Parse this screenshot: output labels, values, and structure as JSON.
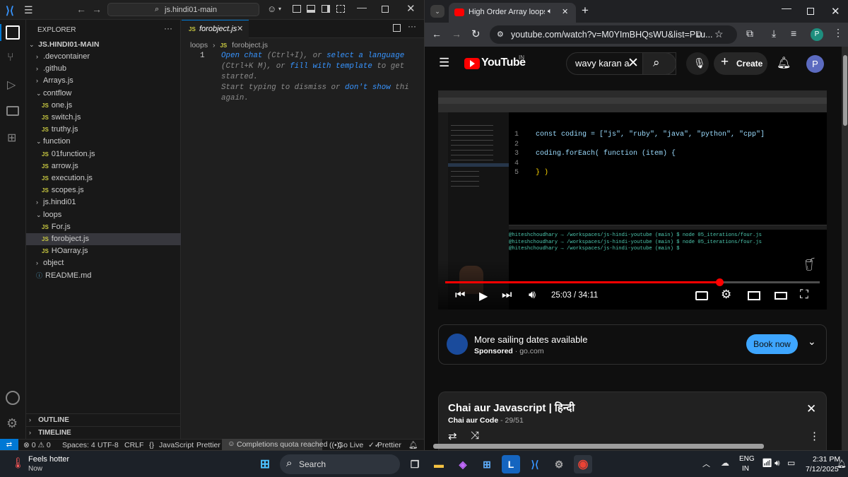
{
  "vscode": {
    "search_text": "js.hindi01-main",
    "explorer_label": "EXPLORER",
    "root_folder": "JS.HINDI01-MAIN",
    "tree": [
      {
        "label": ".devcontainer",
        "kind": "folder-closed",
        "depth": 1
      },
      {
        "label": ".github",
        "kind": "folder-closed",
        "depth": 1
      },
      {
        "label": "Arrays.js",
        "kind": "folder-closed",
        "depth": 1
      },
      {
        "label": "contflow",
        "kind": "folder-open",
        "depth": 1
      },
      {
        "label": "one.js",
        "kind": "js",
        "depth": 2
      },
      {
        "label": "switch.js",
        "kind": "js",
        "depth": 2
      },
      {
        "label": "truthy.js",
        "kind": "js",
        "depth": 2
      },
      {
        "label": "function",
        "kind": "folder-open",
        "depth": 1
      },
      {
        "label": "01function.js",
        "kind": "js",
        "depth": 2
      },
      {
        "label": "arrow.js",
        "kind": "js",
        "depth": 2
      },
      {
        "label": "execution.js",
        "kind": "js",
        "depth": 2
      },
      {
        "label": "scopes.js",
        "kind": "js",
        "depth": 2
      },
      {
        "label": "js.hindi01",
        "kind": "folder-closed",
        "depth": 1
      },
      {
        "label": "loops",
        "kind": "folder-open",
        "depth": 1
      },
      {
        "label": "For.js",
        "kind": "js",
        "depth": 2
      },
      {
        "label": "forobject.js",
        "kind": "js",
        "depth": 2,
        "selected": true
      },
      {
        "label": "HOarray.js",
        "kind": "js",
        "depth": 2
      },
      {
        "label": "object",
        "kind": "folder-closed",
        "depth": 1
      },
      {
        "label": "README.md",
        "kind": "md",
        "depth": 1
      }
    ],
    "outline_label": "OUTLINE",
    "timeline_label": "TIMELINE",
    "tab": {
      "prefix": "JS",
      "name": "forobject.js"
    },
    "breadcrumb": [
      "loops",
      "forobject.js"
    ],
    "line_number": "1",
    "hint": {
      "open_chat": "Open chat",
      "k1": "(Ctrl+I), or",
      "select_lang": "select a language",
      "k2": "(Ctrl+K M), or",
      "fill": "fill with template",
      "to_get": "to get",
      "started": "started.",
      "start_typing": "Start typing to dismiss or",
      "dont_show": "don't show",
      "thi": "thi",
      "again": "again."
    },
    "status": {
      "errors": "0",
      "warnings": "0",
      "spaces": "Spaces: 4",
      "encoding": "UTF-8",
      "eol": "CRLF",
      "language": "JavaScript",
      "prettier1": "Prettier",
      "copilot": "Completions quota reached",
      "golive": "Go Live",
      "prettier2": "Prettier"
    }
  },
  "chrome": {
    "tab_title": "High Order Array loops | ch",
    "url": "youtube.com/watch?v=M0YImBHQsWU&list=PLu...",
    "profile_initial": "P"
  },
  "youtube": {
    "logo_text": "YouTube",
    "region": "IN",
    "search_value": "wavy karan a",
    "create_label": "Create",
    "avatar_initial": "P",
    "time_current": "25:03",
    "time_sep": "/",
    "time_total": "34:11",
    "progress": 0.733,
    "video_code": {
      "line1": "const coding = [\"js\", \"ruby\", \"java\", \"python\", \"cpp\"]",
      "line3": "coding.forEach( function (item) {",
      "line5": "} )",
      "nums": [
        "1",
        "2",
        "3",
        "4",
        "5"
      ],
      "term": [
        "@hiteshchoudhary → /workspaces/js-hindi-youtube (main) $ node 05_iterations/four.js",
        "@hiteshchoudhary → /workspaces/js-hindi-youtube (main) $ node 05_iterations/four.js",
        "@hiteshchoudhary → /workspaces/js-hindi-youtube (main) $ "
      ]
    },
    "ad": {
      "title": "More sailing dates available",
      "sponsored": "Sponsored",
      "dot": "·",
      "domain": "go.com",
      "button": "Book now"
    },
    "playlist": {
      "title": "Chai aur Javascript | हिन्दी",
      "channel": "Chai aur Code",
      "dash": "-",
      "position": "29/51"
    }
  },
  "taskbar": {
    "weather_title": "Feels hotter",
    "weather_sub": "Now",
    "search_label": "Search",
    "lang1": "ENG",
    "lang2": "IN",
    "time": "2:31 PM",
    "date": "7/12/2025"
  },
  "colors": {
    "accent_blue": "#0078d4",
    "yt_red": "#ff0000",
    "link_blue": "#3794ff",
    "book_btn": "#3ea6ff"
  }
}
